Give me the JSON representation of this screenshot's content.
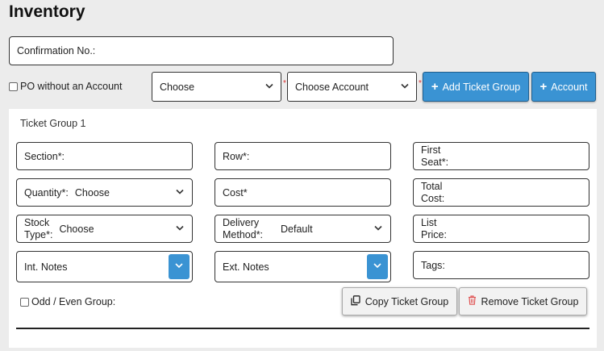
{
  "page": {
    "title": "Inventory"
  },
  "confirmation": {
    "label": "Confirmation No.:"
  },
  "po": {
    "checkbox_label": "PO without an Account",
    "choose_value": "Choose",
    "account_value": "Choose Account",
    "required_mark": "*"
  },
  "buttons": {
    "add_ticket_group": "Add Ticket Group",
    "add_account": "Account",
    "plus": "+",
    "copy_ticket_group": "Copy Ticket Group",
    "remove_ticket_group": "Remove Ticket Group"
  },
  "ticket_group": {
    "title": "Ticket Group 1",
    "section_label": "Section*:",
    "row_label": "Row*:",
    "first_seat_label_1": "First",
    "first_seat_label_2": "Seat*:",
    "quantity_label": "Quantity*:",
    "quantity_value": "Choose",
    "cost_label": "Cost*",
    "total_cost_label_1": "Total",
    "total_cost_label_2": "Cost:",
    "stock_type_label_1": "Stock",
    "stock_type_label_2": "Type*:",
    "stock_type_value": "Choose",
    "delivery_label_1": "Delivery",
    "delivery_label_2": "Method*:",
    "delivery_value": "Default",
    "list_price_label_1": "List",
    "list_price_label_2": "Price:",
    "int_notes_label": "Int. Notes",
    "ext_notes_label": "Ext. Notes",
    "tags_label": "Tags:",
    "odd_even_label": "Odd / Even Group:"
  },
  "icons": {
    "chevron": "chevron-down-icon",
    "copy": "copy-icon",
    "trash": "trash-icon"
  },
  "colors": {
    "accent": "#3a93d3",
    "required": "#d33333",
    "danger_icon": "#e05555"
  }
}
